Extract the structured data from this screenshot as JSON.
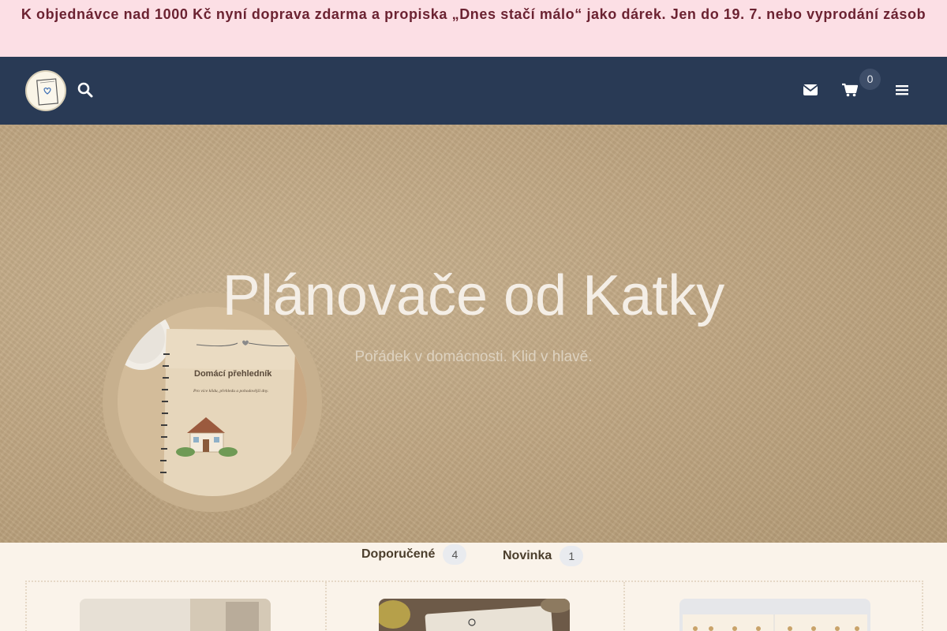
{
  "promo": {
    "text": " K objednávce nad 1000 Kč nyní doprava zdarma a propiska „Dnes stačí málo“ jako dárek. Jen do 19. 7. nebo vyprodání zásob"
  },
  "nav": {
    "logo_icon": "notebook-heart-logo",
    "search_icon": "search-icon",
    "mail_icon": "envelope-icon",
    "cart_icon": "cart-icon",
    "cart_count": "0",
    "menu_icon": "hamburger-menu-icon"
  },
  "hero": {
    "title": "Plánovače od Katky",
    "subtitle": "Pořádek v domácnosti. Klid v hlavě. ",
    "photo_title": "Domácí přehledník",
    "photo_tagline": "Pro více klidu, přehledu a pohodovější dny."
  },
  "tabs": [
    {
      "label": "Doporučené",
      "count": "4"
    },
    {
      "label": "Novinka",
      "count": "1"
    }
  ],
  "colors": {
    "promo_bg": "#fcdfe5",
    "promo_text": "#6b2231",
    "navbar_bg": "#293a55",
    "hero_bg": "#c0a783",
    "page_bg": "#faf3ea"
  }
}
